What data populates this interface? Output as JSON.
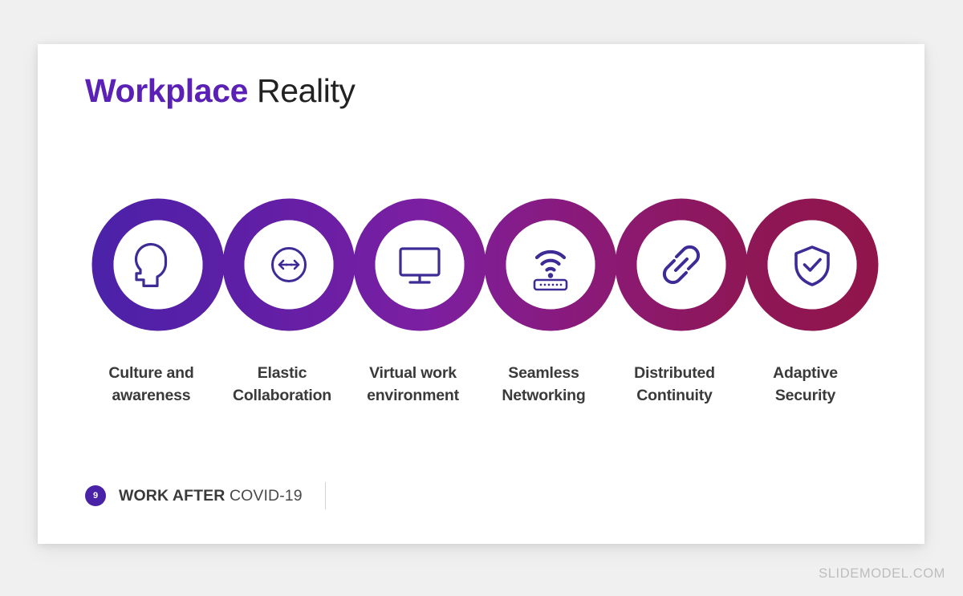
{
  "slide": {
    "title_accent": "Workplace",
    "title_rest": " Reality",
    "background_color": "#f0f0f0",
    "card_color": "#ffffff"
  },
  "theme": {
    "accent_purple": "#5B21B6",
    "gradient_start": "#4A22A8",
    "gradient_mid": "#7B1FA2",
    "gradient_end": "#90154A",
    "icon_color": "#3F2B96",
    "label_color": "#3a3a3a"
  },
  "diagram": {
    "type": "linked-circles",
    "count": 6,
    "items": [
      {
        "icon": "head-profile-icon",
        "label_line1": "Culture and",
        "label_line2": "awareness",
        "ring_color": "#4A22A8"
      },
      {
        "icon": "elastic-resize-arrows-icon",
        "label_line1": "Elastic",
        "label_line2": "Collaboration",
        "ring_color": "#5E1FA6"
      },
      {
        "icon": "desktop-monitor-icon",
        "label_line1": "Virtual work",
        "label_line2": "environment",
        "ring_color": "#701EA4"
      },
      {
        "icon": "wifi-router-icon",
        "label_line1": "Seamless",
        "label_line2": "Networking",
        "ring_color": "#7E1C8E"
      },
      {
        "icon": "chain-link-icon",
        "label_line1": "Distributed",
        "label_line2": "Continuity",
        "ring_color": "#8A1A6E"
      },
      {
        "icon": "shield-check-icon",
        "label_line1": "Adaptive",
        "label_line2": "Security",
        "ring_color": "#90154A"
      }
    ]
  },
  "footer": {
    "page_number": "9",
    "title_strong": "WORK AFTER",
    "title_light": " COVID-19"
  },
  "watermark": {
    "text": "SLIDEMODEL.COM"
  }
}
